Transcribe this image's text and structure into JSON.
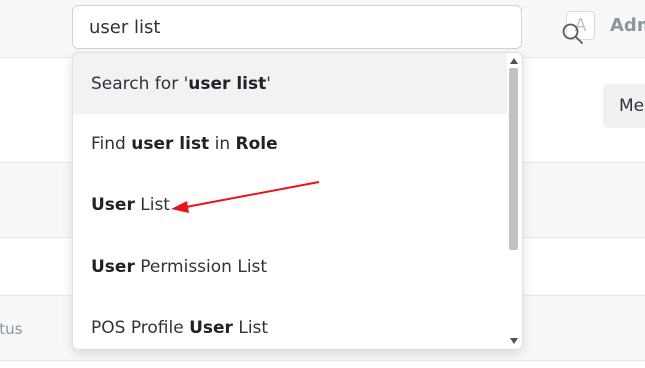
{
  "header": {
    "avatar_letter": "A",
    "user_label": "Adm",
    "menu_label": "Me"
  },
  "search": {
    "value": "user list"
  },
  "dropdown": {
    "items": [
      {
        "parts": [
          {
            "text": "Search for '",
            "bold": false
          },
          {
            "text": "user list",
            "bold": true
          },
          {
            "text": "'",
            "bold": false
          }
        ]
      },
      {
        "parts": [
          {
            "text": "Find ",
            "bold": false
          },
          {
            "text": "user list",
            "bold": true
          },
          {
            "text": " in ",
            "bold": false
          },
          {
            "text": "Role",
            "bold": true
          }
        ]
      },
      {
        "parts": [
          {
            "text": "User",
            "bold": true
          },
          {
            "text": " List",
            "bold": false
          }
        ]
      },
      {
        "parts": [
          {
            "text": "User",
            "bold": true
          },
          {
            "text": " Permission List",
            "bold": false
          }
        ]
      },
      {
        "parts": [
          {
            "text": "POS Profile ",
            "bold": false
          },
          {
            "text": "User",
            "bold": true
          },
          {
            "text": " List",
            "bold": false
          }
        ]
      }
    ]
  },
  "list": {
    "status_label": "atus"
  },
  "colors": {
    "annotation_arrow": "#e8141c",
    "active_item_bg": "#f0f2f4",
    "scroll_thumb": "#c1c1c1"
  }
}
